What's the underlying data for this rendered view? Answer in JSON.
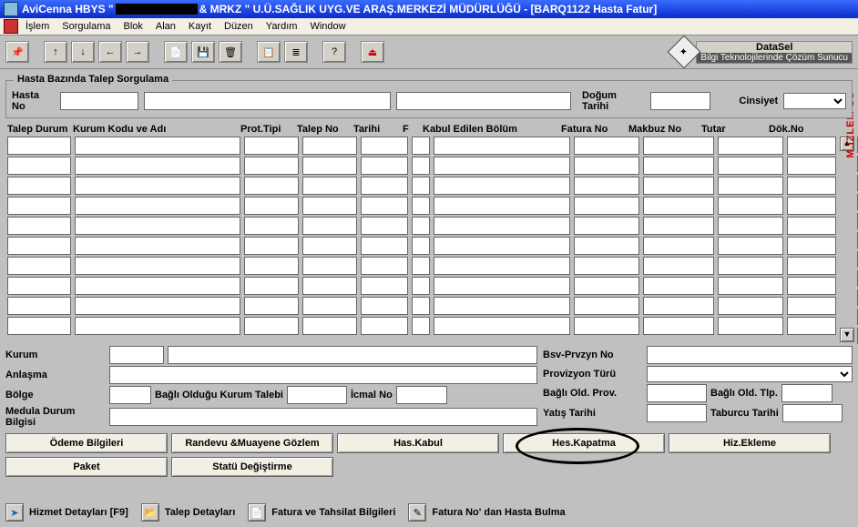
{
  "title_parts": {
    "app": "AviCenna HBYS \"",
    "mid": " & MRKZ \" U.Ü.SAĞLIK UYG.VE ARAŞ.MERKEZİ MÜDÜRLÜĞÜ - [BARQ1122 Hasta Fatur]"
  },
  "menu": [
    "İşlem",
    "Sorgulama",
    "Blok",
    "Alan",
    "Kayıt",
    "Düzen",
    "Yardım",
    "Window"
  ],
  "datasel": {
    "top": "DataSel",
    "bottom": "Bilgi Teknolojilerinde Çözüm Sunucu"
  },
  "vtext": "M.İZLEM SÜ",
  "group": {
    "legend": "Hasta Bazında Talep Sorgulama",
    "hasta_no_lbl": "Hasta No",
    "dogum_lbl": "Doğum Tarihi",
    "cinsiyet_lbl": "Cinsiyet"
  },
  "columns": [
    "Talep Durum",
    "Kurum Kodu ve Adı",
    "Prot.Tipi",
    "Talep No",
    "Tarihi",
    "F",
    "Kabul Edilen Bölüm",
    "Fatura No",
    "Makbuz No",
    "Tutar",
    "Dök.No"
  ],
  "rowcount": 10,
  "lower_left": {
    "kurum": "Kurum",
    "anlasma": "Anlaşma",
    "bolge": "Bölge",
    "bagli_kurum": "Bağlı Olduğu Kurum Talebi",
    "icmal": "İcmal No",
    "medula": "Medula Durum Bilgisi"
  },
  "lower_right": {
    "bsv": "Bsv-Prvzyn No",
    "prov_tur": "Provizyon Türü",
    "bagli_prov": "Bağlı Old. Prov.",
    "bagli_tlp": "Bağlı Old. Tlp.",
    "yatis": "Yatış Tarihi",
    "taburcu": "Taburcu Tarihi"
  },
  "buttons": {
    "odeme": "Ödeme Bilgileri",
    "randevu": "Randevu &Muayene Gözlem",
    "has_kabul": "Has.Kabul",
    "hes_kapatma": "Hes.Kapatma",
    "hiz_ekleme": "Hiz.Ekleme",
    "paket": "Paket",
    "statu": "Statü Değiştirme"
  },
  "bottom": {
    "hizmet": "Hizmet Detayları [F9]",
    "talep": "Talep Detayları",
    "fatura": "Fatura ve Tahsilat Bilgileri",
    "fno": "Fatura No' dan Hasta Bulma"
  },
  "icons": {
    "arrow": "➤",
    "folder": "📂",
    "doc": "📄",
    "wand": "✎"
  }
}
